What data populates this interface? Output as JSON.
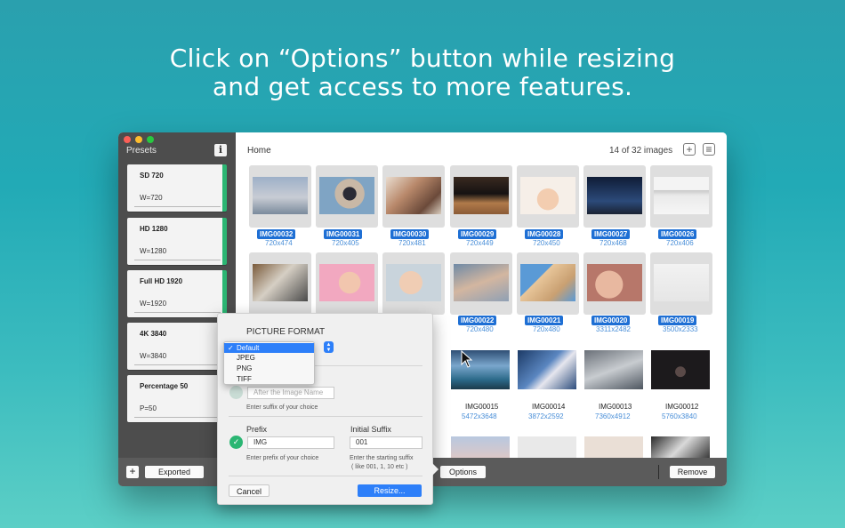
{
  "headline": {
    "line1": "Click on “Options” button while resizing",
    "line2": "and get access to more features."
  },
  "sidebar": {
    "title": "Presets",
    "info_label": "i",
    "presets": [
      {
        "name": "SD 720",
        "value": "W=720"
      },
      {
        "name": "HD 1280",
        "value": "W=1280"
      },
      {
        "name": "Full HD 1920",
        "value": "W=1920"
      },
      {
        "name": "4K 3840",
        "value": "W=3840"
      },
      {
        "name": "Percentage 50",
        "value": "P=50"
      }
    ],
    "accent": "#2bb673"
  },
  "main": {
    "breadcrumb": "Home",
    "count": "14 of 32 images",
    "add_icon": "+",
    "list_icon": "≡"
  },
  "row1": [
    {
      "name": "IMG00032",
      "size": "720x474"
    },
    {
      "name": "IMG00031",
      "size": "720x405"
    },
    {
      "name": "IMG00030",
      "size": "720x481"
    },
    {
      "name": "IMG00029",
      "size": "720x449"
    },
    {
      "name": "IMG00028",
      "size": "720x450"
    },
    {
      "name": "IMG00027",
      "size": "720x468"
    },
    {
      "name": "IMG00026",
      "size": "720x406"
    }
  ],
  "row2": [
    {
      "name": "IMG00022",
      "size": "720x480"
    },
    {
      "name": "IMG00021",
      "size": "720x480"
    },
    {
      "name": "IMG00020",
      "size": "3311x2482"
    },
    {
      "name": "IMG00019",
      "size": "3500x2333"
    }
  ],
  "row3": [
    {
      "name": "IMG00015",
      "size": "5472x3648"
    },
    {
      "name": "IMG00014",
      "size": "3872x2592"
    },
    {
      "name": "IMG00013",
      "size": "7360x4912"
    },
    {
      "name": "IMG00012",
      "size": "5760x3840"
    }
  ],
  "bottombar": {
    "add_label": "+",
    "exported_label": "Exported",
    "options_label": "Options",
    "remove_label": "Remove"
  },
  "popover": {
    "format_title": "PICTURE FORMAT",
    "format_options": [
      "Default",
      "JPEG",
      "PNG",
      "TIFF"
    ],
    "format_selected": "Default",
    "suffix_placeholder": "After the Image Name",
    "suffix_hint": "Enter suffix of your choice",
    "prefix_label": "Prefix",
    "prefix_value": "IMG",
    "prefix_hint": "Enter prefix of your choice",
    "initial_suffix_label": "Initial Suffix",
    "initial_suffix_value": "001",
    "initial_suffix_hint_1": "Enter the starting suffix",
    "initial_suffix_hint_2": "( like 001, 1, 10 etc )",
    "cancel_label": "Cancel",
    "resize_label": "Resize...",
    "check_mark": "✓"
  }
}
